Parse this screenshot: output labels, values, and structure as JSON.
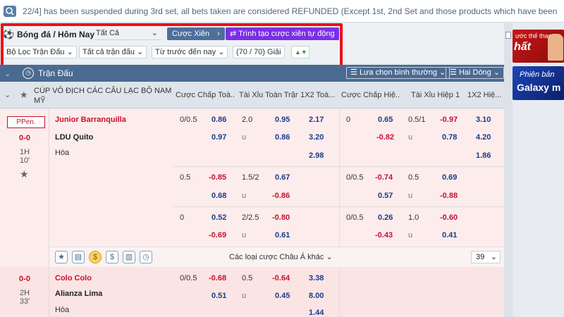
{
  "ticker": {
    "icon": "search-icon",
    "text": "22/4] has been suspended during 3rd set, all bets taken are considered REFUNDED (Except 1st, 2nd Set and those products which have been determined"
  },
  "filters": {
    "sport_label": "Bóng đá / Hôm Nay",
    "all_select": "Tất Cả",
    "parlay_button": "Cược Xiên",
    "auto_parlay_button": "Trình tạo cược xiên tự động",
    "match_filter": "Bộ Lọc Trận Đấu",
    "all_matches": "Tất cả trận đấu",
    "sort_order": "Từ trước đến nay",
    "league_count": "(70 / 70) Giải"
  },
  "section": {
    "title": "Trận Đấu",
    "view_select": "Lựa chọn bình thường",
    "lines_select": "Hai Dòng"
  },
  "columns": {
    "league": "CÚP VÔ ĐỊCH CÁC CÂU LẠC BỘ NAM MỸ",
    "ft_hdp": "Cược Chấp Toà...",
    "ft_ou": "Tài Xỉu Toàn Trận",
    "ft_1x2": "1X2 Toà...",
    "h1_hdp": "Cược Chấp Hiệ...",
    "h1_ou": "Tài Xỉu Hiệp 1",
    "h1_1x2": "1X2 Hiệ..."
  },
  "match1": {
    "badge": "PPen.",
    "score": "0-0",
    "period": "1H",
    "minute": "10'",
    "home": "Junior Barranquilla",
    "away": "LDU Quito",
    "draw": "Hòa",
    "rows": [
      {
        "ft_hdp_line": "0/0.5",
        "ft_hdp_home": "0.86",
        "ft_hdp_away": "0.97",
        "ft_ou_line": "2.0",
        "ft_ou_over": "0.95",
        "ft_ou_under_label": "u",
        "ft_ou_under": "0.86",
        "ft_1x2_home": "2.17",
        "ft_1x2_away": "3.20",
        "ft_1x2_draw": "2.98",
        "h1_hdp_line": "0",
        "h1_hdp_home": "0.65",
        "h1_hdp_away": "-0.82",
        "h1_ou_line": "0.5/1",
        "h1_ou_over": "-0.97",
        "h1_ou_under_label": "u",
        "h1_ou_under": "0.78",
        "h1_1x2_home": "3.10",
        "h1_1x2_away": "4.20",
        "h1_1x2_draw": "1.86"
      },
      {
        "ft_hdp_line": "0.5",
        "ft_hdp_home": "-0.85",
        "ft_hdp_away": "0.68",
        "ft_ou_line": "1.5/2",
        "ft_ou_over": "0.67",
        "ft_ou_under_label": "u",
        "ft_ou_under": "-0.86",
        "h1_hdp_line": "0/0.5",
        "h1_hdp_home": "-0.74",
        "h1_hdp_away": "0.57",
        "h1_ou_line": "0.5",
        "h1_ou_over": "0.69",
        "h1_ou_under_label": "u",
        "h1_ou_under": "-0.88"
      },
      {
        "ft_hdp_line": "0",
        "ft_hdp_home": "0.52",
        "ft_hdp_away": "-0.69",
        "ft_ou_line": "2/2.5",
        "ft_ou_over": "-0.80",
        "ft_ou_under_label": "u",
        "ft_ou_under": "0.61",
        "h1_hdp_line": "0/0.5",
        "h1_hdp_home": "0.26",
        "h1_hdp_away": "-0.43",
        "h1_ou_line": "1.0",
        "h1_ou_over": "-0.60",
        "h1_ou_under_label": "u",
        "h1_ou_under": "0.41"
      }
    ],
    "more_bets": "Các loại cược Châu Á khác",
    "more_count": "39"
  },
  "match2": {
    "score": "0-0",
    "period": "2H",
    "minute": "33'",
    "home": "Colo Colo",
    "away": "Alianza Lima",
    "draw": "Hòa",
    "ft_hdp_line": "0/0.5",
    "ft_hdp_home": "-0.68",
    "ft_hdp_away": "0.51",
    "ft_ou_line": "0.5",
    "ft_ou_over": "-0.64",
    "ft_ou_under_label": "u",
    "ft_ou_under": "0.45",
    "ft_1x2_home": "3.38",
    "ft_1x2_away": "8.00",
    "ft_1x2_draw": "1.44"
  },
  "banners": {
    "banner1_text": "ước thế thao",
    "banner1_big": "hất",
    "banner2_line1": "Phiên bản",
    "banner2_line2": "Galaxy m"
  },
  "colors": {
    "accent": "#4b6a91",
    "highlight_box": "#f10d1a",
    "purple_button": "#7a2fe6",
    "negative_odds": "#c8102e",
    "positive_odds": "#1a3c8c"
  }
}
